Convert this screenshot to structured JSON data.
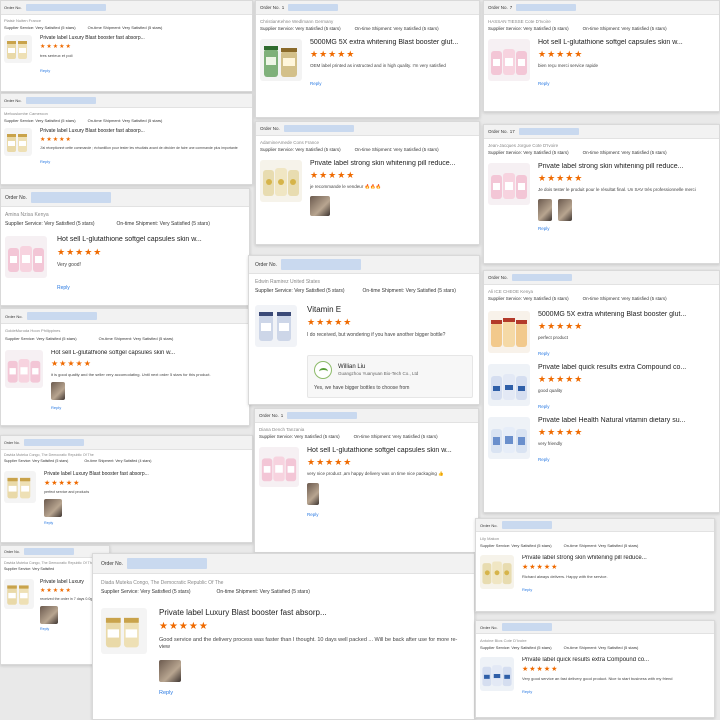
{
  "common": {
    "order_label": "Order No.",
    "supplier_label": "Supplier Service:",
    "shipment_label": "On-time Shipment:",
    "rating_value": "Very Satisfied",
    "rating_stars": "(5 stars)",
    "rating_stars_4": "(4 stars)",
    "reply_label": "Reply",
    "star_glyphs": "★★★★★",
    "order_suffix_1": "1",
    "order_suffix_2": "7",
    "order_suffix_3": "17",
    "order_suffix_4": "1"
  },
  "colors": {
    "accent_star": "#ef6a00",
    "reply_link": "#2a7ae2",
    "order_mask": "#c9d9ef"
  },
  "reviews": [
    {
      "buyer": "Plaisir Nuiten France",
      "title": "Private label Luxury Blast booster fast absorp...",
      "comment": "tres serieux et poli"
    },
    {
      "buyer": "ChristianKehne Wedlmann Germany",
      "title": "5000MG 5X extra whitening Blast booster glut...",
      "comment": "OEM label printed as instructed and in high quality. I'm very satisfied"
    },
    {
      "buyer": "HASSAN TIESSE Cote D'Ivoire",
      "title": "Hot sell L-glutathione softgel capsules skin w...",
      "comment": "bien reçu merci service rapide"
    },
    {
      "buyer": "Mefouslomhe Cameroon",
      "title": "Private label Luxury Blast booster fast absorp...",
      "comment": "J'ai réceptionné cette commande ; échantillon pour tester les résultats avant de décider de faire une commande plus importante"
    },
    {
      "buyer": "AdamineAmede Cons France",
      "title": "Private label strong skin whitening pill reduce...",
      "comment": "je recommande le vendeur 🔥🔥🔥"
    },
    {
      "buyer": "Jean-Jacques Jorgue Cote D'Ivoire",
      "title": "Private label strong skin whitening pill reduce...",
      "comment": "Je dois tester le produit pour le résultat final. Un SAV très professionnelle merci"
    },
    {
      "buyer": "Amina Nzisa Kenya",
      "title": "Hot sell L-glutathione softgel capsules skin w...",
      "comment": "Very good!"
    },
    {
      "buyer": "Edwin Ramirez United States",
      "title": "Vitamin E",
      "comment": "I do received, but wondering if you have another bigger bottle?",
      "seller_name": "Willian Liu",
      "seller_company": "Guangzhou Yuanyuan Bio-Tech Co., Ltd",
      "seller_reply": "Yes, we have bigger bottles to choose from"
    },
    {
      "buyer": "GoldeMuroda Hoon Philippines",
      "title": "Hot sell L-glutathione softgel capsules skin w...",
      "comment": "it is good quality and the seller very accomodating. Until next order 5 stars for this product."
    },
    {
      "buyer": "Ali ICE CHEOE Kenya",
      "titles": [
        "5000MG 5X extra whitening Blast booster glut...",
        "Private label quick results extra Compound co...",
        "Private label Health Natural vitamin dietary su..."
      ],
      "comments": [
        "perfect product",
        "good quality",
        "very friendly"
      ]
    },
    {
      "buyer": "Diana Dench Tanzania",
      "title": "Hot sell L-glutathione softgel capsules skin w...",
      "comment": "very nice product ,am happy delivery was on time nice packaging 👍"
    },
    {
      "buyer": "Davida Muteka Congo, The Democratic Republic Of The",
      "title": "Private label Luxury Blast booster fast absorp...",
      "comment": "perfect service and products"
    },
    {
      "buyer": "Lily Makon",
      "title": "Private label strong skin whitening pill reduce...",
      "comment": "Richard always delivers. Happy with the service."
    },
    {
      "buyer": "Davida Muteka Congo, The Democratic Republic Of The",
      "title": "Private label Luxury",
      "comment": "received the order in 7 days 0.0gam"
    },
    {
      "buyer": "Diada Muteka Congo, The Democratic Republic Of The",
      "title": "Private label Luxury Blast booster fast absorp...",
      "comment": "Good service and the delivery process was faster than I thought. 10 days  well packed ... Will be back after use for more re-view"
    },
    {
      "buyer": "Antoine Bios Cote D'Ivoire",
      "title": "Private label quick results extra Compound co...",
      "comment": "Very good service an fast delivery good product. Nice to start business with my friend"
    }
  ]
}
